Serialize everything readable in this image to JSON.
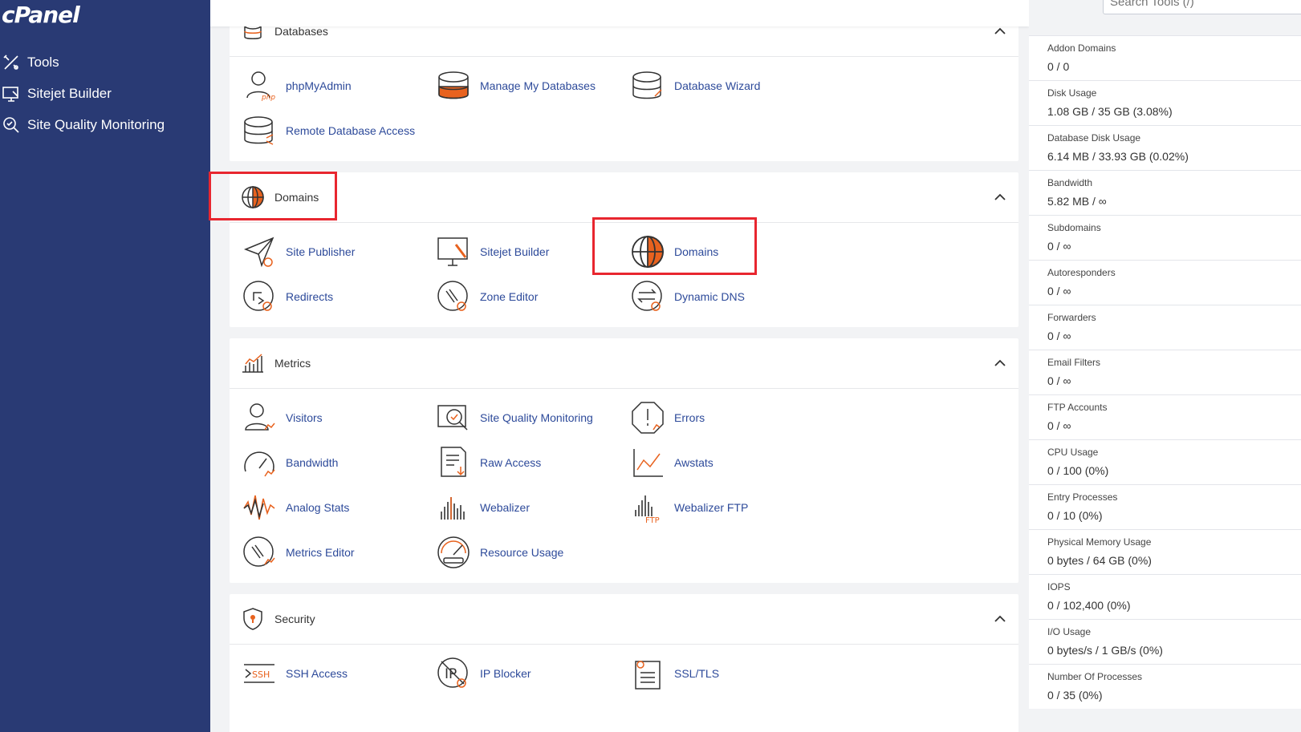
{
  "sidebar": {
    "logo": "cPanel",
    "items": [
      {
        "label": "Tools"
      },
      {
        "label": "Sitejet Builder"
      },
      {
        "label": "Site Quality Monitoring"
      }
    ]
  },
  "search": {
    "placeholder": "Search Tools (/)"
  },
  "sections": {
    "databases": {
      "title": "Databases",
      "items": [
        "phpMyAdmin",
        "Manage My Databases",
        "Database Wizard",
        "Remote Database Access"
      ]
    },
    "domains": {
      "title": "Domains",
      "items": [
        "Site Publisher",
        "Sitejet Builder",
        "Domains",
        "Redirects",
        "Zone Editor",
        "Dynamic DNS"
      ]
    },
    "metrics": {
      "title": "Metrics",
      "items": [
        "Visitors",
        "Site Quality Monitoring",
        "Errors",
        "Bandwidth",
        "Raw Access",
        "Awstats",
        "Analog Stats",
        "Webalizer",
        "Webalizer FTP",
        "Metrics Editor",
        "Resource Usage"
      ]
    },
    "security": {
      "title": "Security",
      "items": [
        "SSH Access",
        "IP Blocker",
        "SSL/TLS"
      ]
    }
  },
  "stats": [
    {
      "label": "Addon Domains",
      "value": "0 / 0"
    },
    {
      "label": "Disk Usage",
      "value": "1.08 GB / 35 GB   (3.08%)"
    },
    {
      "label": "Database Disk Usage",
      "value": "6.14 MB / 33.93 GB   (0.02%)"
    },
    {
      "label": "Bandwidth",
      "value": "5.82 MB / ∞"
    },
    {
      "label": "Subdomains",
      "value": "0 / ∞"
    },
    {
      "label": "Autoresponders",
      "value": "0 / ∞"
    },
    {
      "label": "Forwarders",
      "value": "0 / ∞"
    },
    {
      "label": "Email Filters",
      "value": "0 / ∞"
    },
    {
      "label": "FTP Accounts",
      "value": "0 / ∞"
    },
    {
      "label": "CPU Usage",
      "value": "0 / 100   (0%)"
    },
    {
      "label": "Entry Processes",
      "value": "0 / 10   (0%)"
    },
    {
      "label": "Physical Memory Usage",
      "value": "0 bytes / 64 GB   (0%)"
    },
    {
      "label": "IOPS",
      "value": "0 / 102,400   (0%)"
    },
    {
      "label": "I/O Usage",
      "value": "0 bytes/s / 1 GB/s   (0%)"
    },
    {
      "label": "Number Of Processes",
      "value": "0 / 35   (0%)"
    }
  ],
  "colors": {
    "sidebar_bg": "#293a74",
    "accent": "#e8621e",
    "link": "#2d4a9a",
    "highlight": "#e8262f"
  }
}
